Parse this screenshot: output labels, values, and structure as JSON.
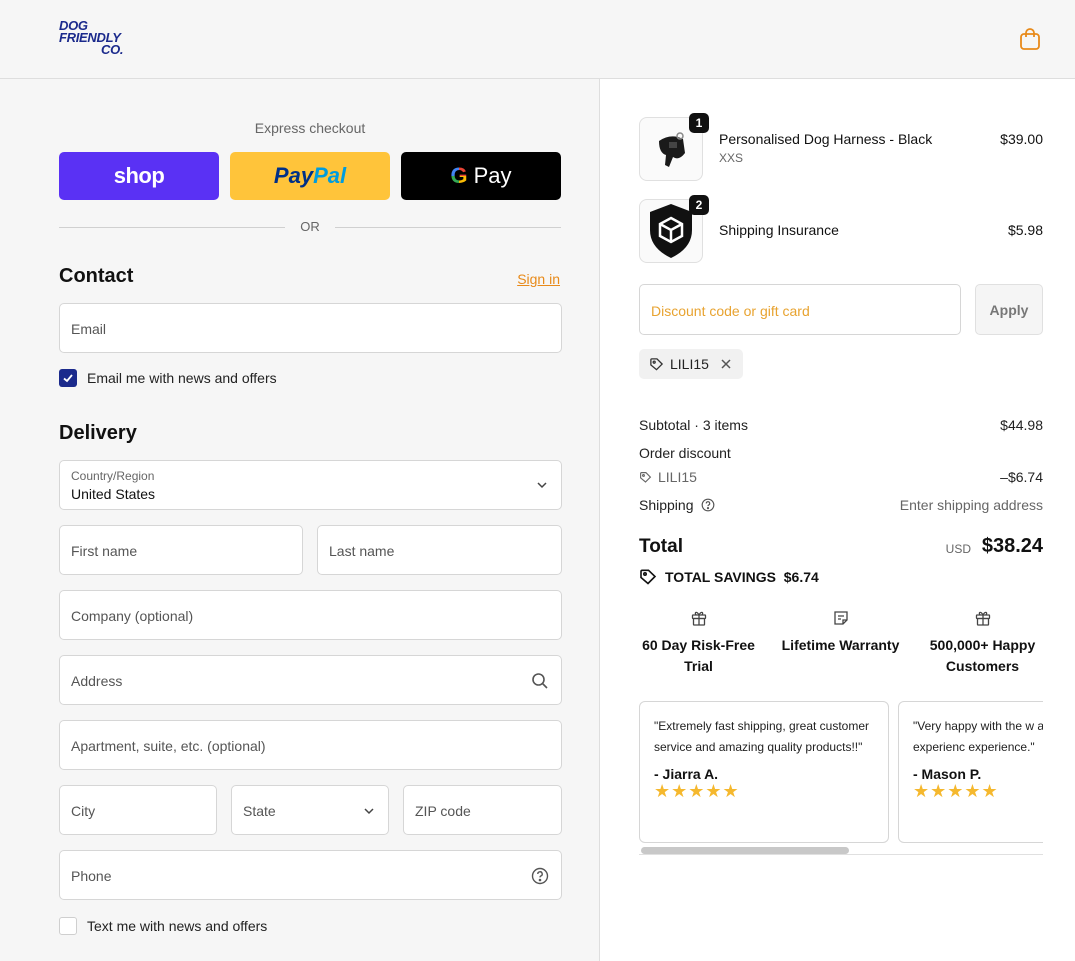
{
  "header": {
    "logo_lines": [
      "DOG",
      "FRIENDLY",
      "CO."
    ]
  },
  "express": {
    "label": "Express checkout",
    "shop_label": "shop",
    "paypal_label_1": "Pay",
    "paypal_label_2": "Pal",
    "gpay_g": "G",
    "gpay_label": "Pay",
    "or_label": "OR"
  },
  "contact": {
    "title": "Contact",
    "sign_in": "Sign in",
    "email_placeholder": "Email",
    "news_checkbox_label": "Email me with news and offers"
  },
  "delivery": {
    "title": "Delivery",
    "country_label": "Country/Region",
    "country_value": "United States",
    "first_name": "First name",
    "last_name": "Last name",
    "company": "Company (optional)",
    "address": "Address",
    "apartment": "Apartment, suite, etc. (optional)",
    "city": "City",
    "state": "State",
    "zip": "ZIP code",
    "phone": "Phone",
    "text_checkbox_label": "Text me with news and offers"
  },
  "cart": {
    "items": [
      {
        "qty": "1",
        "name": "Personalised Dog Harness - Black",
        "variant": "XXS",
        "price": "$39.00"
      },
      {
        "qty": "2",
        "name": "Shipping Insurance",
        "variant": "",
        "price": "$5.98"
      }
    ],
    "discount_placeholder": "Discount code or gift card",
    "apply_label": "Apply",
    "applied_code": "LILI15"
  },
  "summary": {
    "subtotal_label": "Subtotal · 3 items",
    "subtotal_value": "$44.98",
    "order_discount_label": "Order discount",
    "discount_code": "LILI15",
    "discount_value": "–$6.74",
    "shipping_label": "Shipping",
    "shipping_value": "Enter shipping address",
    "total_label": "Total",
    "currency": "USD",
    "total_value": "$38.24",
    "savings_label": "TOTAL SAVINGS",
    "savings_value": "$6.74"
  },
  "perks": [
    {
      "line1": "60 Day Risk-Free",
      "line2": "Trial",
      "icon": "gift-icon"
    },
    {
      "line1": "Lifetime Warranty",
      "line2": "",
      "icon": "note-icon"
    },
    {
      "line1": "500,000+ Happy",
      "line2": "Customers",
      "icon": "gift-icon"
    }
  ],
  "reviews": [
    {
      "quote": "\"Extremely fast shipping, great customer service and amazing quality products!!\"",
      "author": "- Jiarra A.",
      "stars": "★★★★★"
    },
    {
      "quote": "\"Very happy with the w and shipping experienc experience.\"",
      "author": "- Mason P.",
      "stars": "★★★★★"
    }
  ],
  "colors": {
    "brand_navy": "#1b2a8c",
    "shop_purple": "#5a31f4",
    "paypal_yellow": "#ffc43a",
    "accent_orange": "#e88a1a",
    "star_gold": "#f5b82e"
  }
}
